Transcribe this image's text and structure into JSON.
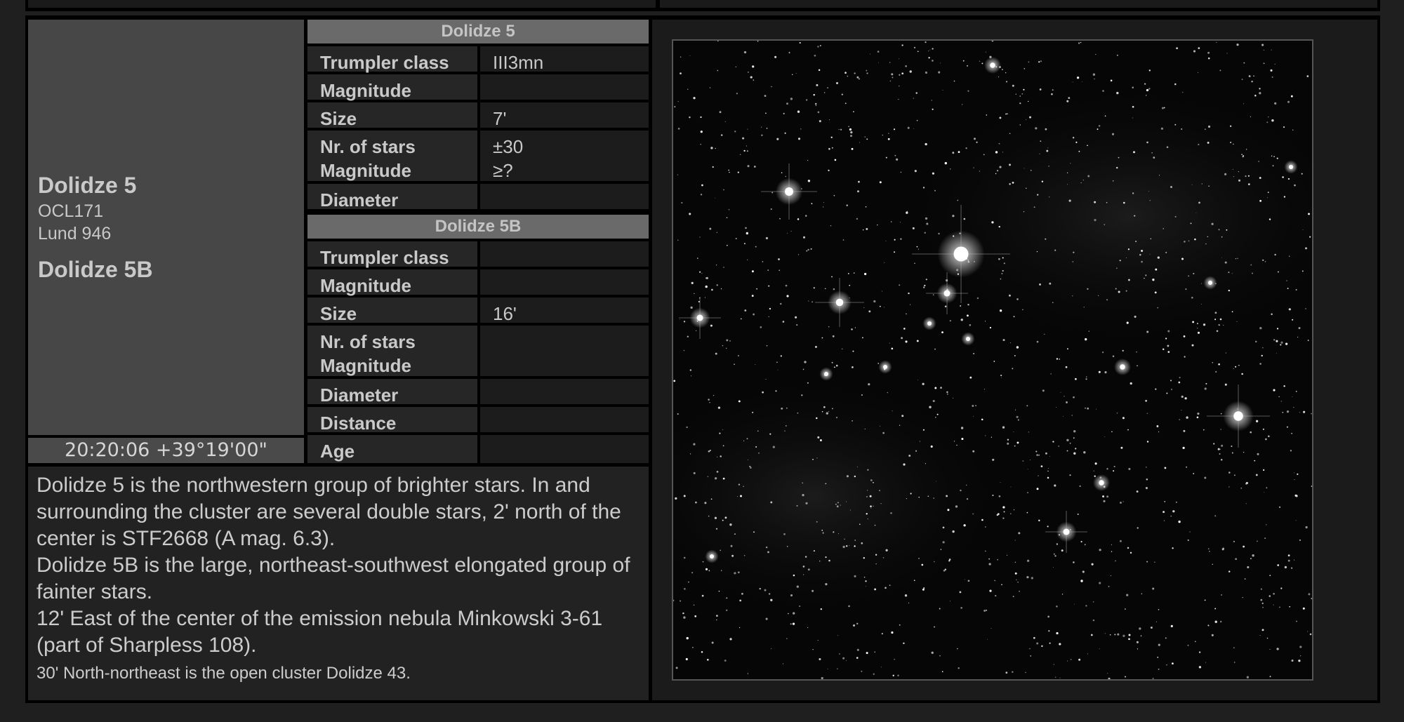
{
  "object": {
    "name": "Dolidze 5",
    "aliases": [
      "OCL171",
      "Lund 946"
    ],
    "second_name": "Dolidze 5B",
    "coordinates": "20:20:06 +39°19'00\""
  },
  "table_a": {
    "header": "Dolidze 5",
    "rows": [
      {
        "label": "Trumpler class",
        "value": "III3mn"
      },
      {
        "label": "Magnitude",
        "value": ""
      },
      {
        "label": "Size",
        "value": "7'"
      },
      {
        "label": "Nr. of stars",
        "value": "±30"
      },
      {
        "label": "Magnitude",
        "value": "≥?"
      },
      {
        "label": "Diameter",
        "value": ""
      }
    ]
  },
  "table_b": {
    "header": "Dolidze 5B",
    "rows": [
      {
        "label": "Trumpler class",
        "value": ""
      },
      {
        "label": "Magnitude",
        "value": ""
      },
      {
        "label": "Size",
        "value": "16'"
      },
      {
        "label": "Nr. of stars",
        "value": ""
      },
      {
        "label": "Magnitude",
        "value": ""
      },
      {
        "label": "Diameter",
        "value": ""
      },
      {
        "label": "Distance",
        "value": ""
      },
      {
        "label": "Age",
        "value": ""
      }
    ]
  },
  "description": [
    "Dolidze 5 is the northwestern group of brighter stars. In and surrounding the cluster are several double stars, 2' north of the center is STF2668 (A mag. 6.3).",
    "Dolidze 5B is the large, northeast-southwest elongated group of fainter stars.",
    "12' East of the center of the emission nebula Minkowski 3-61 (part of Sharpless 108)."
  ],
  "note": "30' North-northeast is the open cluster Dolidze 43.",
  "colors": {
    "background": "#1f1f1f",
    "panel": "#474747",
    "header": "#6a6a6a",
    "text": "#cfcfcf"
  }
}
